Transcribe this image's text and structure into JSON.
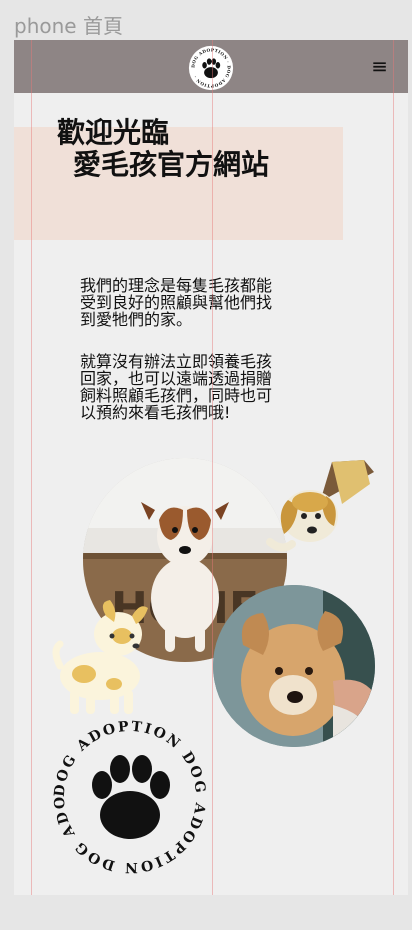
{
  "frame_label": "phone 首頁",
  "header": {
    "logo_text": "DOG ADOPTION · DOG ADOPTION · ",
    "menu_icon": "hamburger-menu-icon",
    "menu_glyph": "≡"
  },
  "hero": {
    "line1": "歡迎光臨",
    "line2": "愛毛孩官方網站"
  },
  "intro": {
    "p1_lines": [
      "我們的理念是每隻毛孩都能",
      "受到良好的照顧與幫他們找",
      "到愛牠們的家。"
    ],
    "p2_lines": [
      "就算沒有辦法立即領養毛孩",
      "回家，也可以遠端透過捐贈",
      "飼料照顧毛孩們，同時也可",
      "以預約來看毛孩們哦!"
    ]
  },
  "photo1": {
    "mat_text": "HOME"
  },
  "seal": {
    "text": "DOG ADOPTION DOG ADOPTION DOG ADOPTION "
  },
  "colors": {
    "header_bg": "#8e8585",
    "hero_bg": "#f0e0d8",
    "page_bg": "#efefef",
    "outer_bg": "#e6e6e6"
  }
}
